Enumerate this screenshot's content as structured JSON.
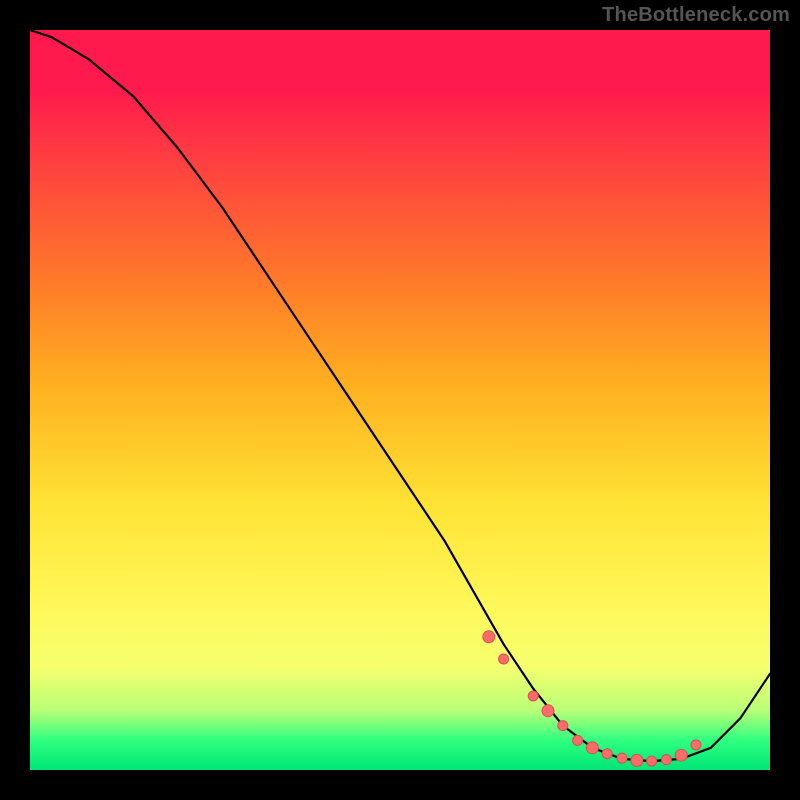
{
  "watermark": "TheBottleneck.com",
  "chart_data": {
    "type": "line",
    "title": "",
    "xlabel": "",
    "ylabel": "",
    "xlim": [
      0,
      100
    ],
    "ylim": [
      0,
      100
    ],
    "grid": false,
    "legend": false,
    "series": [
      {
        "name": "curve",
        "x": [
          0,
          3,
          8,
          14,
          20,
          26,
          32,
          38,
          44,
          50,
          56,
          60,
          64,
          68,
          72,
          76,
          80,
          84,
          88,
          92,
          96,
          100
        ],
        "y": [
          100,
          99,
          96,
          91,
          84,
          76,
          67,
          58,
          49,
          40,
          31,
          24,
          17,
          11,
          6,
          3,
          1.5,
          1.2,
          1.5,
          3,
          7,
          13
        ]
      }
    ],
    "points": {
      "name": "markers",
      "x": [
        62,
        64,
        68,
        70,
        72,
        74,
        76,
        78,
        80,
        82,
        84,
        86,
        88,
        90
      ],
      "y": [
        18,
        15,
        10,
        8,
        6,
        4,
        3,
        2.2,
        1.6,
        1.3,
        1.2,
        1.4,
        2.0,
        3.4
      ]
    },
    "background_gradient": {
      "top": "#ff1a4d",
      "mid": "#ffe335",
      "bottom": "#00e676"
    }
  }
}
